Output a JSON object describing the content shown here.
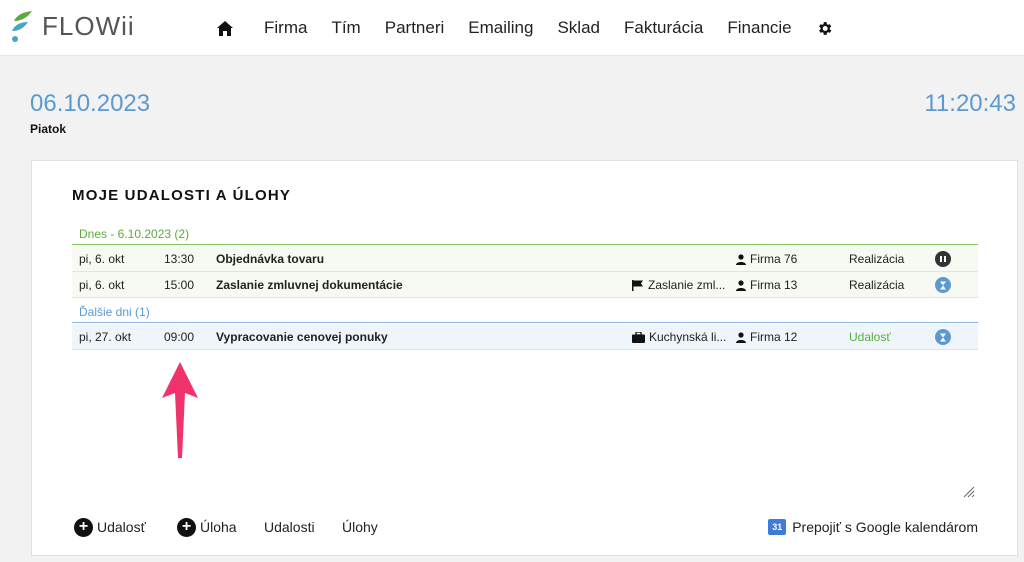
{
  "brand": {
    "name": "FLOWii",
    "color_blue": "#5b9ad0",
    "color_green": "#5aab3d"
  },
  "nav": {
    "items": [
      {
        "label": "Firma"
      },
      {
        "label": "Tím"
      },
      {
        "label": "Partneri"
      },
      {
        "label": "Emailing"
      },
      {
        "label": "Sklad"
      },
      {
        "label": "Fakturácia"
      },
      {
        "label": "Financie"
      }
    ],
    "home_icon": "home-icon",
    "settings_icon": "gear-icon"
  },
  "header": {
    "date": "06.10.2023",
    "weekday": "Piatok",
    "time": "11:20:43"
  },
  "panel": {
    "title": "MOJE UDALOSTI A ÚLOHY",
    "sections": [
      {
        "label": "Dnes - 6.10.2023 (2)",
        "rows": [
          {
            "day": "pi, 6. okt",
            "time": "13:30",
            "title": "Objednávka tovaru",
            "tag": "",
            "firm": "Firma 76",
            "status": "Realizácia",
            "action_icon": "pause-icon"
          },
          {
            "day": "pi, 6. okt",
            "time": "15:00",
            "title": "Zaslanie zmluvnej dokumentácie",
            "tag": "Zaslanie zml...",
            "tag_icon": "flag-icon",
            "firm": "Firma 13",
            "status": "Realizácia",
            "action_icon": "hourglass-icon"
          }
        ]
      },
      {
        "label": "Ďalšie dni (1)",
        "rows": [
          {
            "day": "pi, 27. okt",
            "time": "09:00",
            "title": "Vypracovanie cenovej ponuky",
            "tag": "Kuchynská li...",
            "tag_icon": "briefcase-icon",
            "firm": "Firma 12",
            "status": "Udalosť",
            "action_icon": "hourglass-icon"
          }
        ]
      }
    ],
    "footer": {
      "add_event": "Udalosť",
      "add_task": "Úloha",
      "events": "Udalosti",
      "tasks": "Úlohy",
      "google_calendar": "Prepojiť s Google kalendárom",
      "google_calendar_icon_text": "31"
    }
  }
}
